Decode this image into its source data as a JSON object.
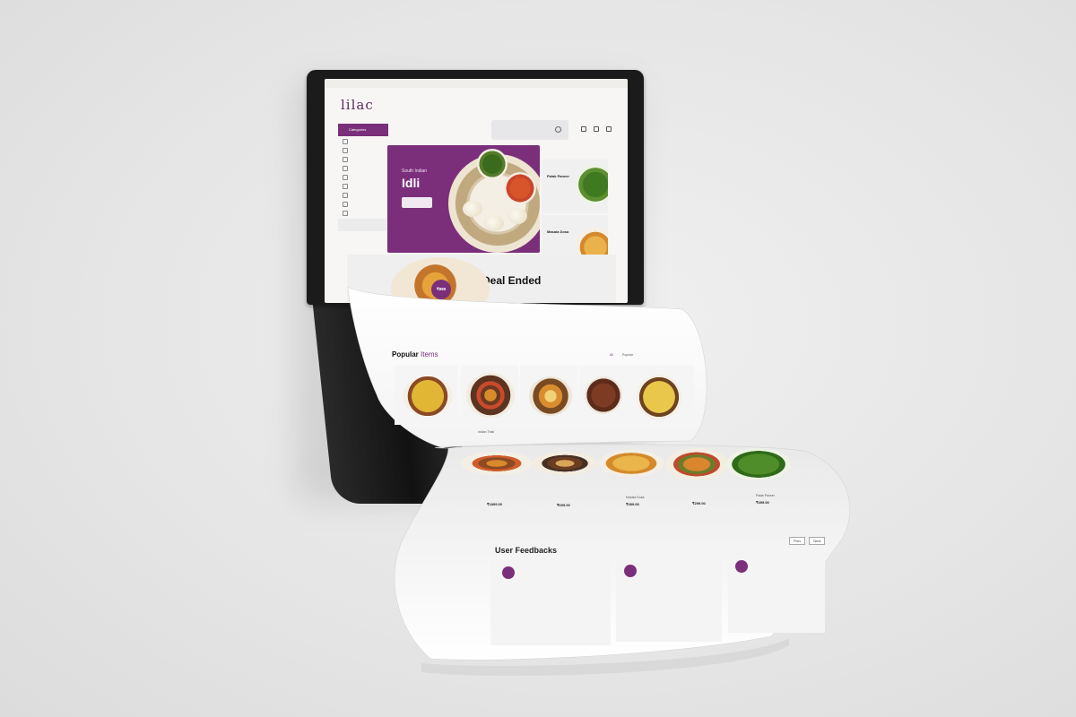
{
  "colors": {
    "brand_purple": "#7b2f7b",
    "background": "#e7e7e7",
    "paper": "#ffffff"
  },
  "screen": {
    "topbar_text": "",
    "logo": "lilac",
    "logo_sub": "",
    "search_placeholder": "",
    "categories": {
      "header": "Categories",
      "items": [
        "",
        "",
        "",
        "",
        "",
        "",
        "",
        "",
        ""
      ],
      "footer": ""
    },
    "hero": {
      "subtitle": "South Indian",
      "title": "Idli",
      "button": ""
    },
    "side_cards": [
      {
        "subtitle": "",
        "title": "Palak Paneer"
      },
      {
        "subtitle": "",
        "title": "Masala Dosa"
      }
    ],
    "deal": {
      "badge": "₹899",
      "title": "Deal Ended",
      "text": ""
    }
  },
  "popular": {
    "title_part1": "Popular",
    "title_part2": "Items",
    "filters": [
      "All",
      "Popular",
      "",
      ""
    ],
    "items_row1": [
      {
        "name": "",
        "price": ""
      },
      {
        "name": "Indian Thali",
        "price": ""
      },
      {
        "name": "",
        "price": ""
      },
      {
        "name": "",
        "price": ""
      },
      {
        "name": "",
        "price": ""
      }
    ],
    "items_row2": [
      {
        "name": "",
        "price": "₹1899.00"
      },
      {
        "name": "",
        "price": "₹699.00"
      },
      {
        "name": "Masala Dosa",
        "price": "₹499.00"
      },
      {
        "name": "",
        "price": "₹299.00"
      },
      {
        "name": "Palak Paneer",
        "price": "₹499.00"
      }
    ]
  },
  "feedback": {
    "title": "User Feedbacks",
    "prev": "Prev",
    "next": "Next",
    "cards": [
      {
        "initials": "",
        "text": ""
      },
      {
        "initials": "",
        "text": ""
      },
      {
        "initials": "",
        "text": ""
      }
    ]
  }
}
